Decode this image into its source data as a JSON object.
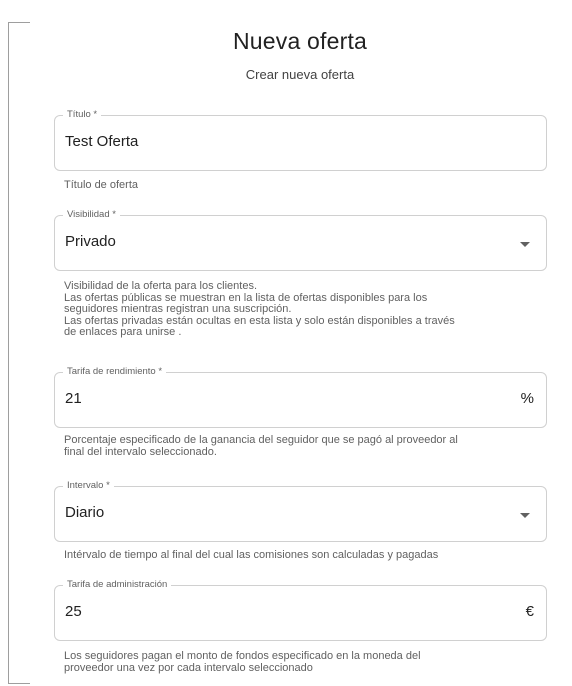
{
  "header": {
    "title": "Nueva oferta",
    "subtitle": "Crear nueva oferta"
  },
  "form": {
    "titulo": {
      "label": "Título *",
      "value": "Test Oferta",
      "helper": "Título de oferta"
    },
    "visibilidad": {
      "label": "Visibilidad *",
      "value": "Privado",
      "icon": "chevron-down-icon",
      "helper": [
        "Visibilidad de la oferta para los clientes.",
        "Las ofertas públicas se muestran en la lista de ofertas disponibles para los",
        "seguidores mientras registran una suscripción.",
        "Las ofertas privadas están ocultas en esta lista y solo están disponibles a través",
        "de enlaces para unirse ."
      ]
    },
    "tarifa_rendimiento": {
      "label": "Tarifa de rendimiento *",
      "value": "21",
      "suffix": "%",
      "helper": [
        "Porcentaje especificado de la ganancia del seguidor que se pagó al proveedor al",
        "final del intervalo seleccionado."
      ]
    },
    "intervalo": {
      "label": "Intervalo *",
      "value": "Diario",
      "icon": "chevron-down-icon",
      "helper": "Intérvalo de tiempo al final del cual las comisiones son calculadas y pagadas"
    },
    "tarifa_administracion": {
      "label": "Tarifa de administración",
      "value": "25",
      "suffix": "€",
      "helper": [
        "Los seguidores pagan el monto de fondos especificado en la moneda del",
        "proveedor una vez por cada intervalo seleccionado"
      ]
    }
  },
  "colors": {
    "border": "#d0d0d0",
    "text": "#212121",
    "helper_text": "#616161"
  }
}
